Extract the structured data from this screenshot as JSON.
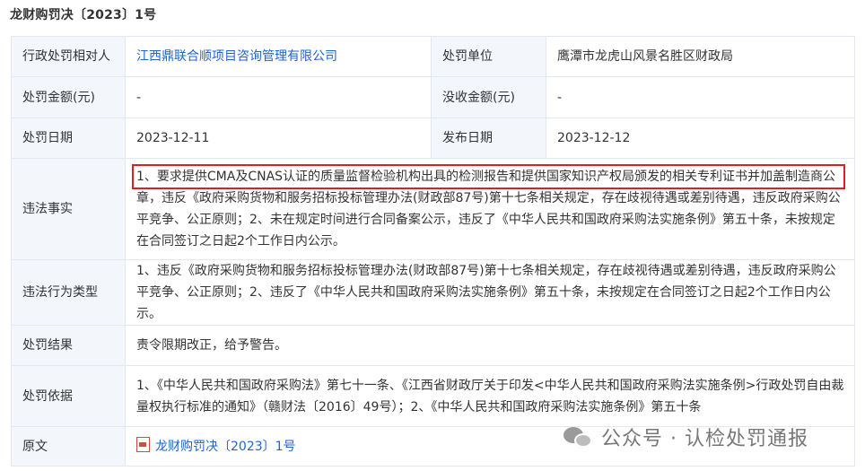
{
  "title": "龙财购罚决〔2023〕1号",
  "rows": {
    "party_label": "行政处罚相对人",
    "party_value": "江西鼎联合顺项目咨询管理有限公司",
    "unit_label": "处罚单位",
    "unit_value": "鹰潭市龙虎山风景名胜区财政局",
    "amount_label": "处罚金额(元)",
    "amount_value": "-",
    "confiscated_label": "没收金额(元)",
    "confiscated_value": "-",
    "date_label": "处罚日期",
    "date_value": "2023-12-11",
    "publish_label": "发布日期",
    "publish_value": "2023-12-12",
    "facts_label": "违法事实",
    "facts_value": "1、要求提供CMA及CNAS认证的质量监督检验机构出具的检测报告和提供国家知识产权局颁发的相关专利证书并加盖制造商公章，违反《政府采购货物和服务招标投标管理办法(财政部87号)第十七条相关规定，存在歧视待遇或差别待遇，违反政府采购公平竞争、公正原则；2、未在规定时间进行合同备案公示，违反了《中华人民共和国政府采购法实施条例》第五十条，未按规定在合同签订之日起2个工作日内公示。",
    "type_label": "违法行为类型",
    "type_value": "1、违反《政府采购货物和服务招标投标管理办法(财政部87号)第十七条相关规定，存在歧视待遇或差别待遇，违反政府采购公平竞争、公正原则；2、违反了《中华人民共和国政府采购法实施条例》第五十条，未按规定在合同签订之日起2个工作日内公示。",
    "result_label": "处罚结果",
    "result_value": "责令限期改正，给予警告。",
    "basis_label": "处罚依据",
    "basis_value": "1、《中华人民共和国政府采购法》第七十一条、《江西省财政厅关于印发<中华人民共和国政府采购法实施条例>行政处罚自由裁量权执行标准的通知》（赣财法〔2016〕49号）；2、《中华人民共和国政府采购法实施条例》第五十条",
    "original_label": "原文",
    "original_value": "龙财购罚决〔2023〕1号"
  },
  "watermark": "公众号 · 认检处罚通报",
  "colors": {
    "link": "#1f63d6",
    "highlight": "#e11d1d",
    "label_bg": "#f3f6fb",
    "border": "#e3e7ee"
  }
}
